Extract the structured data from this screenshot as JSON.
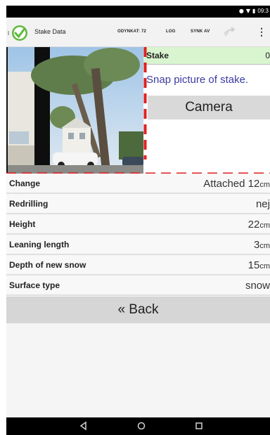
{
  "status_bar": {
    "time": "09:3",
    "icons": [
      "location-icon",
      "wifi-icon",
      "battery-icon"
    ]
  },
  "action_bar": {
    "app_title": "Stake Data",
    "menu_items": [
      "ODYNKAT: 72",
      "LOG",
      "SYNK AV"
    ],
    "icons": [
      "app-logo-icon",
      "sync-icon",
      "overflow-menu-icon"
    ],
    "brand_color": "#5fb83a"
  },
  "stake_panel": {
    "label": "Stake",
    "value": "0",
    "instruction": "Snap picture of stake.",
    "camera_label": "Camera",
    "header_color": "#d8f5d0",
    "instruction_color": "#3b3ba3"
  },
  "rows": [
    {
      "label": "Change",
      "value": "Attached 12",
      "unit": "cm"
    },
    {
      "label": "Redrilling",
      "value": "nej",
      "unit": ""
    },
    {
      "label": "Height",
      "value": "22",
      "unit": "cm"
    },
    {
      "label": "Leaning length",
      "value": "3",
      "unit": "cm"
    },
    {
      "label": "Depth of new snow",
      "value": "15",
      "unit": "cm"
    },
    {
      "label": "Surface type",
      "value": "snow",
      "unit": ""
    }
  ],
  "back_label": "« Back",
  "nav_icons": [
    "back-nav-icon",
    "home-nav-icon",
    "recents-nav-icon"
  ],
  "accent_dash_color": "#e02020"
}
